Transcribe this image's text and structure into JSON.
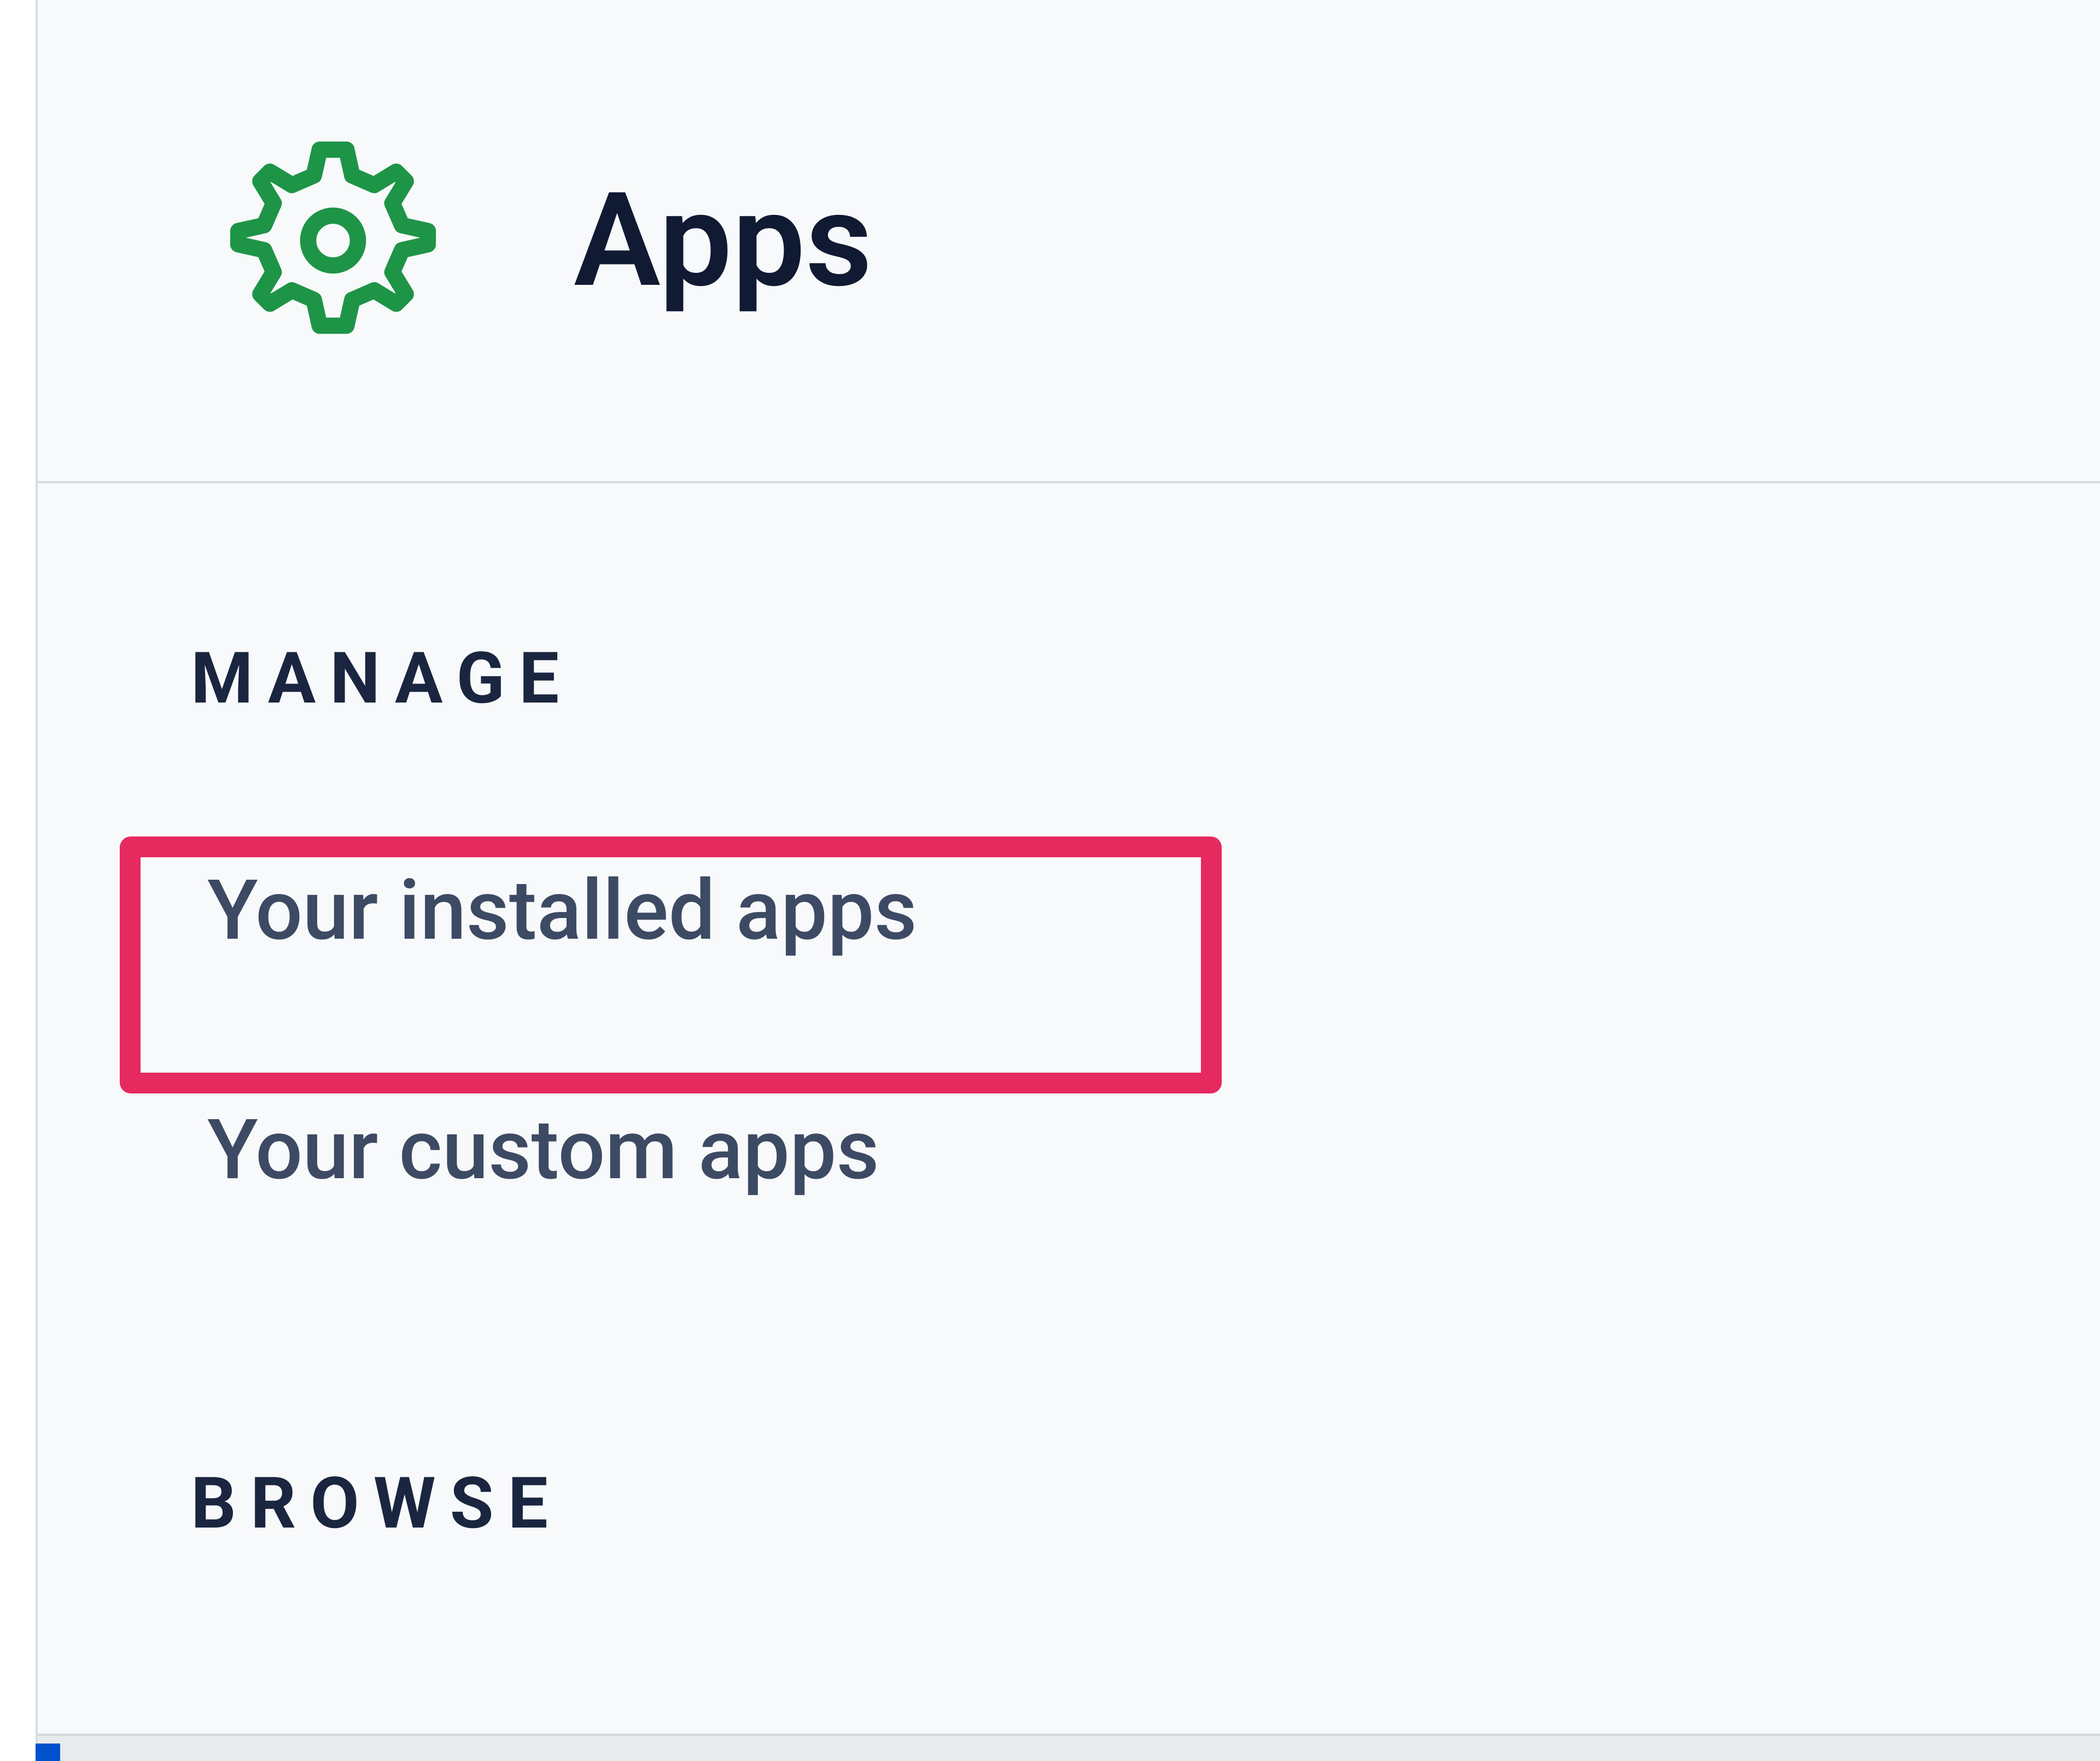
{
  "header": {
    "title": "Apps",
    "icon_name": "gear-icon",
    "icon_color": "#1e9447"
  },
  "sections": [
    {
      "heading": "MANAGE",
      "items": [
        {
          "label": "Your installed apps",
          "highlighted": true
        },
        {
          "label": "Your custom apps",
          "highlighted": false
        }
      ]
    },
    {
      "heading": "BROWSE",
      "items": []
    }
  ],
  "highlight_color": "#e6295f"
}
